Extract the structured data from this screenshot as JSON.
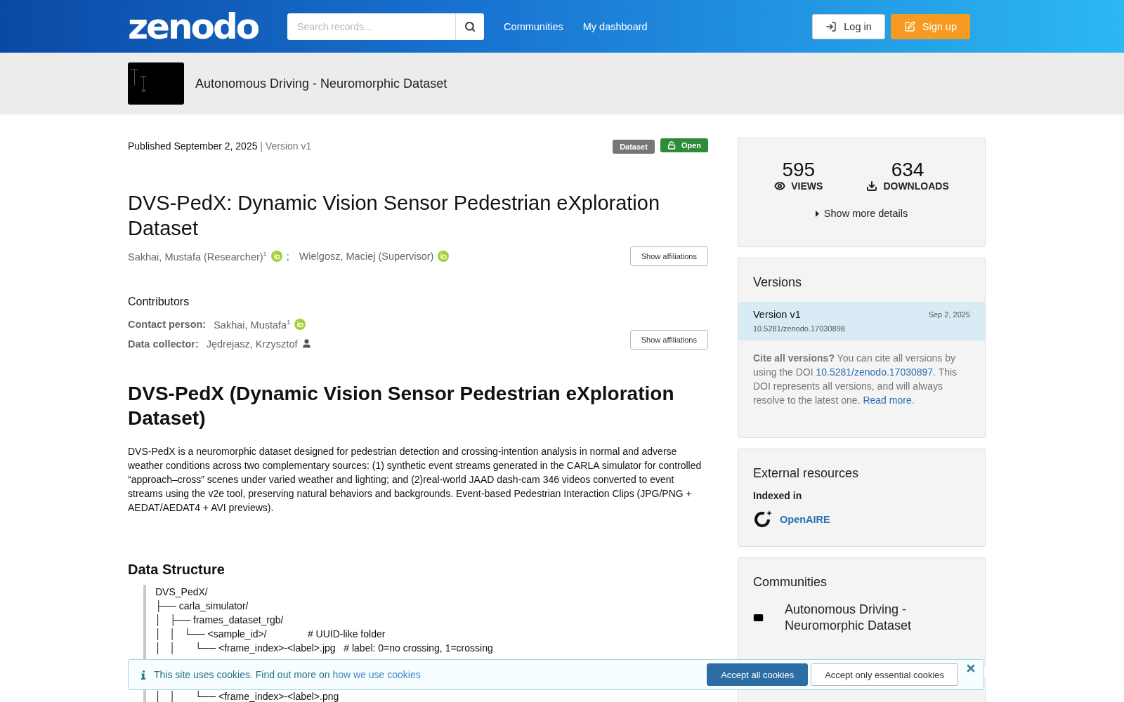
{
  "header": {
    "logo": "zenodo",
    "search": {
      "placeholder": "Search records..."
    },
    "nav": [
      "Communities",
      "My dashboard"
    ],
    "buttons": [
      {
        "label": "Log in",
        "kind": "login"
      },
      {
        "label": "Sign up",
        "kind": "signup"
      }
    ]
  },
  "community_banner": {
    "title": "Autonomous Driving - Neuromorphic Dataset"
  },
  "record": {
    "published": "Published September 2, 2025",
    "version_separator": "|",
    "version": "Version v1",
    "badges": [
      {
        "label": "Dataset",
        "kind": "type"
      },
      {
        "label": "Open",
        "kind": "access"
      }
    ],
    "title": "DVS-PedX: Dynamic Vision Sensor Pedestrian eXploration Dataset",
    "creators": [
      {
        "name": "Sakhai, Mustafa (Researcher)",
        "sup": "1",
        "kind": "orcid"
      },
      {
        "name": "Wielgosz, Maciej (Supervisor)",
        "kind": "orcid"
      }
    ],
    "creator_separator": ";",
    "affiliations_button": "Show affiliations",
    "contributors_heading": "Contributors",
    "contributors": [
      {
        "role": "Contact person:",
        "name": "Sakhai, Mustafa",
        "sup": "1",
        "kind": "orcid"
      },
      {
        "role": "Data collector:",
        "name": "Jędrejasz, Krzysztof",
        "kind": "person"
      }
    ],
    "contributors_button": "Show affiliations",
    "description_heading": "DVS-PedX (Dynamic Vision Sensor Pedestrian eXploration Dataset)",
    "description": "DVS-PedX is a neuromorphic dataset designed for pedestrian detection and crossing-intention analysis in normal and adverse weather conditions across two complementary sources: (1) synthetic event streams generated in the CARLA simulator for controlled “approach–cross” scenes under varied weather and lighting; and (2)real-world JAAD dash-cam 346 videos converted to event streams using the v2e tool, preserving natural behaviors and backgrounds. Event-based Pedestrian Interaction Clips (JPG/PNG + AEDAT/AEDAT4 + AVI previews).",
    "structure_heading": "Data Structure",
    "tree": [
      "DVS_PedX/",
      "├── carla_simulator/",
      "│   ├── frames_dataset_rgb/",
      "│   │   └── <sample_id>/               # UUID-like folder",
      "│   │       └── <frame_index>-<label>.jpg   # label: 0=no crossing, 1=crossing"
    ],
    "tree_below_banner": [
      "│   │       └── <frame_index>-<label>.png"
    ]
  },
  "sidebar": {
    "stats": [
      {
        "value": "595",
        "label": "VIEWS",
        "kind": "views"
      },
      {
        "value": "634",
        "label": "DOWNLOADS",
        "kind": "downloads"
      }
    ],
    "show_more": "Show more details",
    "versions": {
      "title": "Versions",
      "items": [
        {
          "label": "Version v1",
          "date": "Sep 2, 2025",
          "doi": "10.5281/zenodo.17030898",
          "selected": true
        }
      ],
      "cite": {
        "lead": "Cite all versions?",
        "text1": " You can cite all versions by using the DOI ",
        "doi_link": "10.5281/zenodo.17030897",
        "text2": ". This DOI represents all versions, and will always resolve to the latest one. ",
        "read_more": "Read more",
        "text3": "."
      }
    },
    "external": {
      "title": "External resources",
      "indexed_in": "Indexed in",
      "items": [
        {
          "name": "OpenAIRE"
        }
      ]
    },
    "communities": {
      "title": "Communities",
      "items": [
        {
          "name": "Autonomous Driving - Neuromorphic Dataset"
        }
      ]
    }
  },
  "cookie_banner": {
    "text": "This site uses cookies. Find out more on ",
    "link": "how we use cookies",
    "accept_all": "Accept all cookies",
    "accept_essential": "Accept only essential cookies"
  }
}
